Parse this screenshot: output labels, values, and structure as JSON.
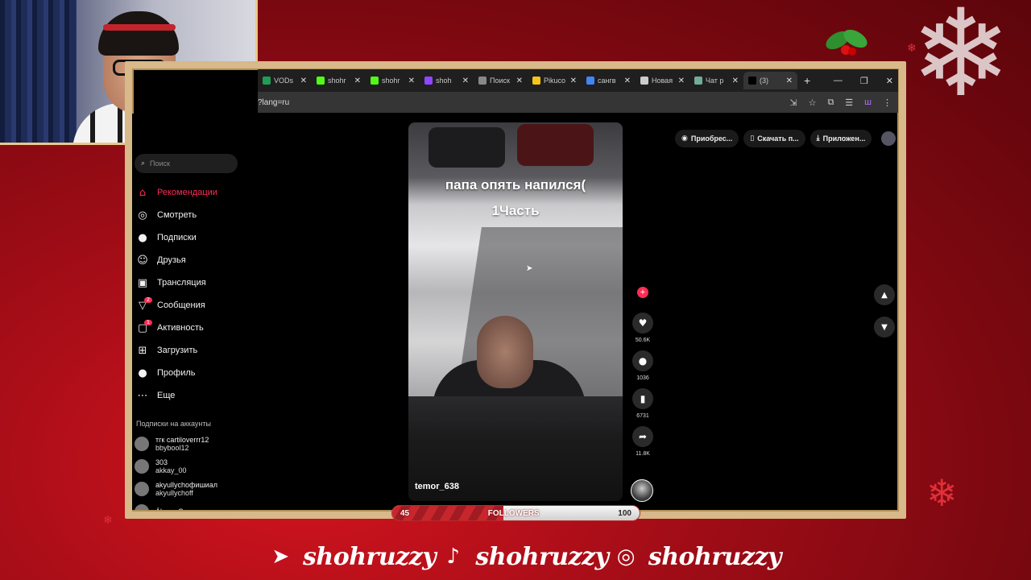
{
  "browser": {
    "tabs": [
      {
        "label": "VODs",
        "color": "#1f9d55"
      },
      {
        "label": "shohr",
        "color": "#53fc18"
      },
      {
        "label": "shohr",
        "color": "#53fc18"
      },
      {
        "label": "shoh",
        "color": "#9146ff"
      },
      {
        "label": "Поиск",
        "color": "#888888"
      },
      {
        "label": "Pikuco",
        "color": "#f5c518"
      },
      {
        "label": "сангв",
        "color": "#4285f4"
      },
      {
        "label": "Новая",
        "color": "#cccccc"
      },
      {
        "label": "Чат р",
        "color": "#74aa9c"
      },
      {
        "label": "(3)",
        "color": "#000000"
      }
    ],
    "url": "?lang=ru"
  },
  "tiktok": {
    "search_placeholder": "Поиск",
    "nav": [
      {
        "label": "Рекомендации",
        "icon": "home-icon",
        "glyph": "⌂",
        "active": true
      },
      {
        "label": "Смотреть",
        "icon": "compass-icon",
        "glyph": "◎"
      },
      {
        "label": "Подписки",
        "icon": "following-icon",
        "glyph": "●"
      },
      {
        "label": "Друзья",
        "icon": "friends-icon",
        "glyph": "☺"
      },
      {
        "label": "Трансляция",
        "icon": "live-icon",
        "glyph": "▣"
      },
      {
        "label": "Сообщения",
        "icon": "messages-icon",
        "glyph": "▽",
        "badge": "2"
      },
      {
        "label": "Активность",
        "icon": "activity-icon",
        "glyph": "▢",
        "badge": "1"
      },
      {
        "label": "Загрузить",
        "icon": "upload-icon",
        "glyph": "⊞"
      },
      {
        "label": "Профиль",
        "icon": "profile-icon",
        "glyph": "●"
      },
      {
        "label": "Еще",
        "icon": "more-icon",
        "glyph": "⋯"
      }
    ],
    "subs_title": "Подписки на аккаунты",
    "subs": [
      {
        "name": "тгк cartiloverrr12",
        "handle": "bbybool12"
      },
      {
        "name": "303",
        "handle": "akkay_00"
      },
      {
        "name": "akyullychофишиал",
        "handle": "akyullychoff"
      },
      {
        "name": "Álvaro Carreras",
        "handle": ""
      }
    ],
    "top_buttons": [
      "Приобрес...",
      "Скачать п...",
      "Приложен..."
    ],
    "video": {
      "caption_line1": "папа опять напился(",
      "caption_line2": "1Часть",
      "author": "temor_638"
    },
    "actions": {
      "likes": "50.6K",
      "comments": "1036",
      "saves": "6731",
      "shares": "11.8K"
    }
  },
  "overlay": {
    "followers_label": "FOLLOWERS",
    "followers_current": "45",
    "followers_goal": "100",
    "followers_progress": 0.45,
    "socials": [
      {
        "icon": "telegram-icon",
        "glyph": "➤",
        "handle": "shohruzzy"
      },
      {
        "icon": "tiktok-icon",
        "glyph": "♪",
        "handle": "shohruzzy"
      },
      {
        "icon": "instagram-icon",
        "glyph": "◎",
        "handle": "shohruzzy"
      }
    ]
  }
}
